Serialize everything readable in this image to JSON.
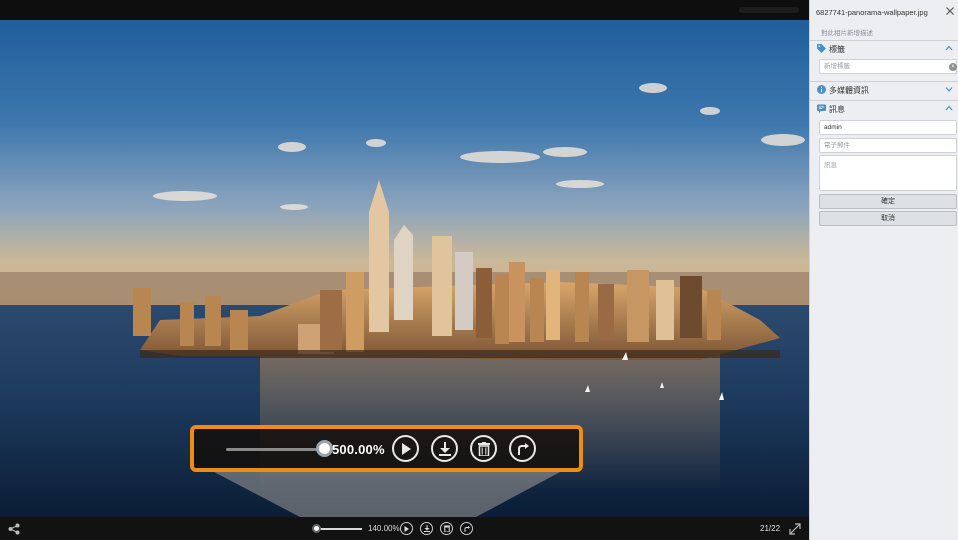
{
  "viewer": {
    "zoom_overlay": {
      "zoom_value": "500.00%",
      "zoom_level": 5.0,
      "icons": [
        "play-icon",
        "download-icon",
        "trash-icon",
        "share-arrow-icon"
      ],
      "highlight_color": "#f08c12"
    },
    "toolbar": {
      "zoom_value": "140.00%",
      "zoom_level": 1.4,
      "counter": "21/22",
      "icons": [
        "share-icon",
        "play-icon",
        "download-icon",
        "trash-icon",
        "share-arrow-icon",
        "expand-icon"
      ]
    }
  },
  "sidebar": {
    "filename": "6827741-panorama-wallpaper.jpg",
    "description_placeholder": "對此相片新增描述",
    "sections": {
      "tags": {
        "label": "標籤",
        "icon": "tag-icon",
        "expanded": true
      },
      "media_info": {
        "label": "多媒體資訊",
        "icon": "info-icon",
        "expanded": false
      },
      "message": {
        "label": "訊息",
        "icon": "message-icon",
        "expanded": true
      }
    },
    "tag_input_placeholder": "新增標籤",
    "name_value": "admin",
    "email_placeholder": "電子郵件",
    "message_placeholder": "訊息",
    "confirm_label": "確定",
    "cancel_label": "取消"
  },
  "colors": {
    "sidebar_bg": "#eceef1",
    "viewer_bg": "#0c0c0c",
    "accent": "#4a90c8"
  }
}
